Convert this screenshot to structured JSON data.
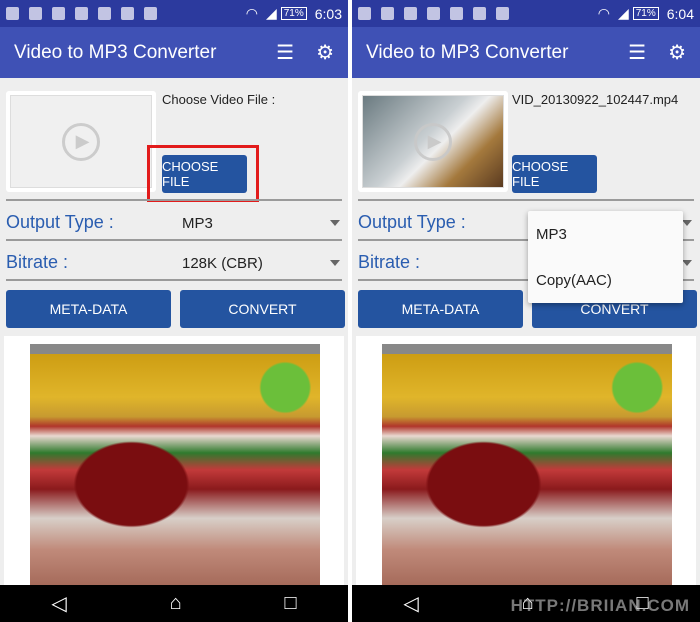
{
  "app_title": "Video to MP3 Converter",
  "icons": {
    "list": "list-icon",
    "settings": "gear-icon",
    "play": "play-icon"
  },
  "colors": {
    "appbar": "#3f51b5",
    "button": "#2454a0",
    "label": "#2a5db0",
    "highlight": "#e21b1b"
  },
  "left": {
    "status": {
      "battery": "71%",
      "time": "6:03"
    },
    "file_label": "Choose Video File :",
    "choose_button": "CHOOSE FILE",
    "output_type_label": "Output Type :",
    "output_type_value": "MP3",
    "bitrate_label": "Bitrate :",
    "bitrate_value": "128K (CBR)",
    "meta_button": "META-DATA",
    "convert_button": "CONVERT"
  },
  "right": {
    "status": {
      "battery": "71%",
      "time": "6:04"
    },
    "file_label": "VID_20130922_102447.mp4",
    "choose_button": "CHOOSE FILE",
    "output_type_label": "Output Type :",
    "bitrate_label": "Bitrate :",
    "dropdown_options": [
      "MP3",
      "Copy(AAC)"
    ],
    "meta_button": "META-DATA",
    "convert_button": "CONVERT"
  },
  "watermark": "HTTP://BRIIAN.COM"
}
